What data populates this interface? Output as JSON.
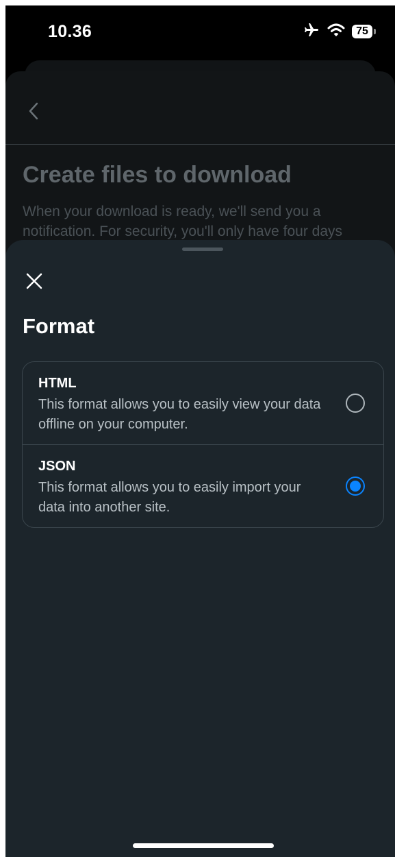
{
  "status_bar": {
    "time": "10.36",
    "battery_level": "75",
    "icons": [
      "airplane-icon",
      "wifi-icon",
      "battery-icon"
    ]
  },
  "background_page": {
    "back_icon": "chevron-left-icon",
    "title": "Create files to download",
    "description": "When your download is ready, we'll send you a notification. For security, you'll only have four days"
  },
  "sheet": {
    "close_icon": "close-icon",
    "title": "Format",
    "options": [
      {
        "title": "HTML",
        "description": "This format allows you to easily view your data offline on your computer.",
        "selected": false
      },
      {
        "title": "JSON",
        "description": "This format allows you to easily import your data into another site.",
        "selected": true
      }
    ]
  },
  "colors": {
    "sheet_background": "#1c252b",
    "accent": "#0a84ff",
    "text_primary": "#ffffff",
    "text_secondary": "#b9c1c6"
  }
}
